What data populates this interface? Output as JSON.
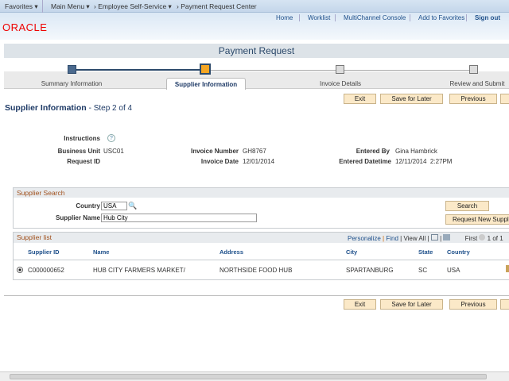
{
  "topbar": {
    "favorites": "Favorites ▾",
    "main_menu": "Main Menu ▾",
    "crumb1": "› Employee Self-Service ▾",
    "crumb2": "› Payment Request Center"
  },
  "nav": {
    "home": "Home",
    "worklist": "Worklist",
    "multichannel": "MultiChannel Console",
    "add_favorites": "Add to Favorites",
    "sign_out": "Sign out"
  },
  "logo": "ORACLE",
  "page_title": "Payment Request",
  "steps": [
    {
      "label": "Summary Information",
      "state": "complete"
    },
    {
      "label": "Supplier Information",
      "state": "current"
    },
    {
      "label": "Invoice Details",
      "state": "pending"
    },
    {
      "label": "Review and Submit",
      "state": "pending"
    }
  ],
  "buttons": {
    "exit": "Exit",
    "save": "Save for Later",
    "previous": "Previous"
  },
  "heading": {
    "title": "Supplier Information",
    "step": "- Step 2 of 4"
  },
  "info": {
    "instructions": "Instructions",
    "business_unit_label": "Business Unit",
    "business_unit": "USC01",
    "request_id_label": "Request ID",
    "invoice_number_label": "Invoice Number",
    "invoice_number": "GH8767",
    "invoice_date_label": "Invoice Date",
    "invoice_date": "12/01/2014",
    "entered_by_label": "Entered By",
    "entered_by": "Gina Hambrick",
    "entered_dt_label": "Entered Datetime",
    "entered_dt": "12/11/2014  2:27PM"
  },
  "search": {
    "title": "Supplier Search",
    "country_label": "Country",
    "country": "USA",
    "name_label": "Supplier Name",
    "name": "Hub City",
    "search_btn": "Search",
    "request_btn": "Request New Suppli"
  },
  "list": {
    "title": "Supplier list",
    "personalize": "Personalize",
    "find": "Find",
    "view_all": "View All",
    "first": "First",
    "count": "1 of 1",
    "columns": [
      "Supplier ID",
      "Name",
      "Address",
      "City",
      "State",
      "Country"
    ],
    "rows": [
      [
        "C000000652",
        "HUB CITY FARMERS MARKET/",
        "NORTHSIDE FOOD HUB",
        "SPARTANBURG",
        "SC",
        "USA"
      ]
    ]
  }
}
